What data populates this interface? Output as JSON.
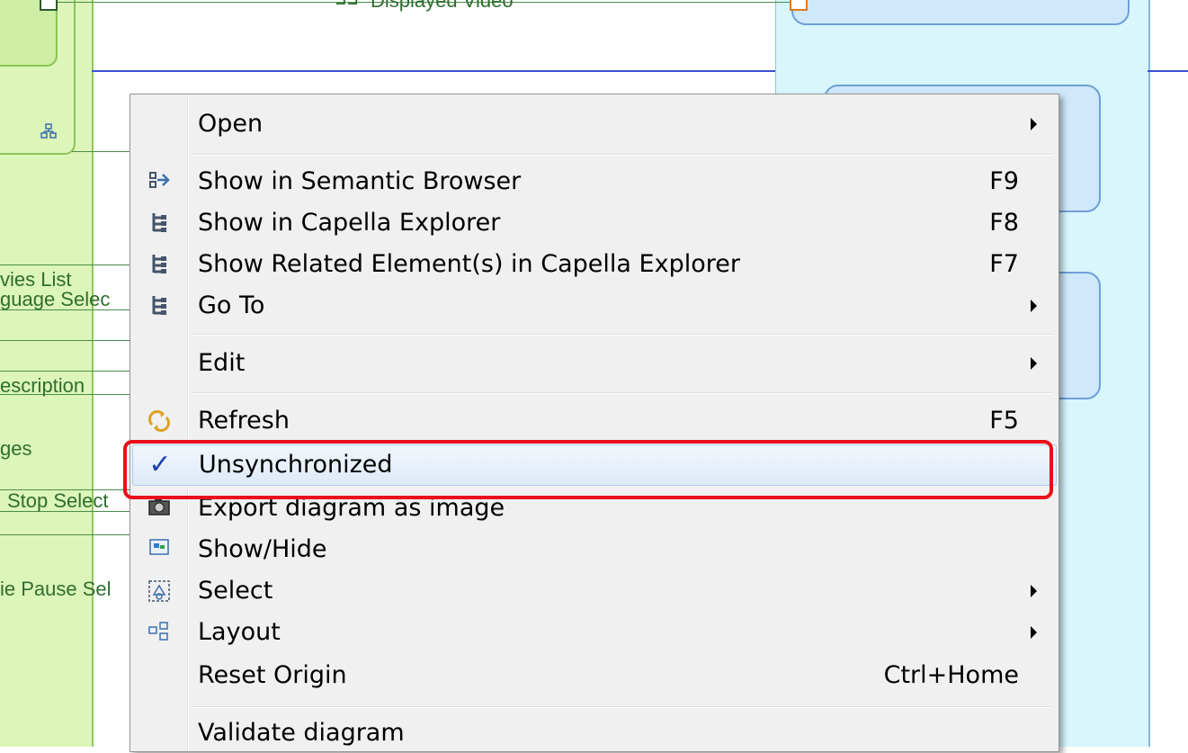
{
  "diagram": {
    "flows": {
      "displayed_video": "Displayed Video",
      "movies_list": "vies List",
      "language_select": "guage Selec",
      "description": "escription",
      "images": "ges",
      "stop_select": "Stop Select",
      "pause_select": "ie Pause Sel"
    },
    "colors": {
      "left_lane": "#dcf5b8",
      "right_lane": "#d8f6fc",
      "flow_line": "#4b8d4b",
      "blue_line": "#3b4fd6"
    }
  },
  "context_menu": {
    "highlight_color": "#e8101a",
    "items": [
      {
        "label": "Open",
        "shortcut": "",
        "submenu": true,
        "icon": ""
      },
      {
        "label": "Show in Semantic Browser",
        "shortcut": "F9",
        "submenu": false,
        "icon": "semantic-browser-icon"
      },
      {
        "label": "Show in Capella Explorer",
        "shortcut": "F8",
        "submenu": false,
        "icon": "tree-icon"
      },
      {
        "label": "Show Related Element(s) in Capella Explorer",
        "shortcut": "F7",
        "submenu": false,
        "icon": "tree-icon"
      },
      {
        "label": "Go To",
        "shortcut": "",
        "submenu": true,
        "icon": "tree-icon"
      },
      {
        "label": "Edit",
        "shortcut": "",
        "submenu": true,
        "icon": ""
      },
      {
        "label": "Refresh",
        "shortcut": "F5",
        "submenu": false,
        "icon": "refresh-icon"
      },
      {
        "label": "Unsynchronized",
        "shortcut": "",
        "submenu": false,
        "icon": "checkmark-icon",
        "checked": true
      },
      {
        "label": "Export diagram as image",
        "shortcut": "",
        "submenu": false,
        "icon": "camera-icon"
      },
      {
        "label": "Show/Hide",
        "shortcut": "",
        "submenu": false,
        "icon": "show-hide-icon"
      },
      {
        "label": "Select",
        "shortcut": "",
        "submenu": true,
        "icon": "select-icon"
      },
      {
        "label": "Layout",
        "shortcut": "",
        "submenu": true,
        "icon": "layout-icon"
      },
      {
        "label": "Reset Origin",
        "shortcut": "Ctrl+Home",
        "submenu": false,
        "icon": ""
      },
      {
        "label": "Validate diagram",
        "shortcut": "",
        "submenu": false,
        "icon": ""
      }
    ]
  }
}
